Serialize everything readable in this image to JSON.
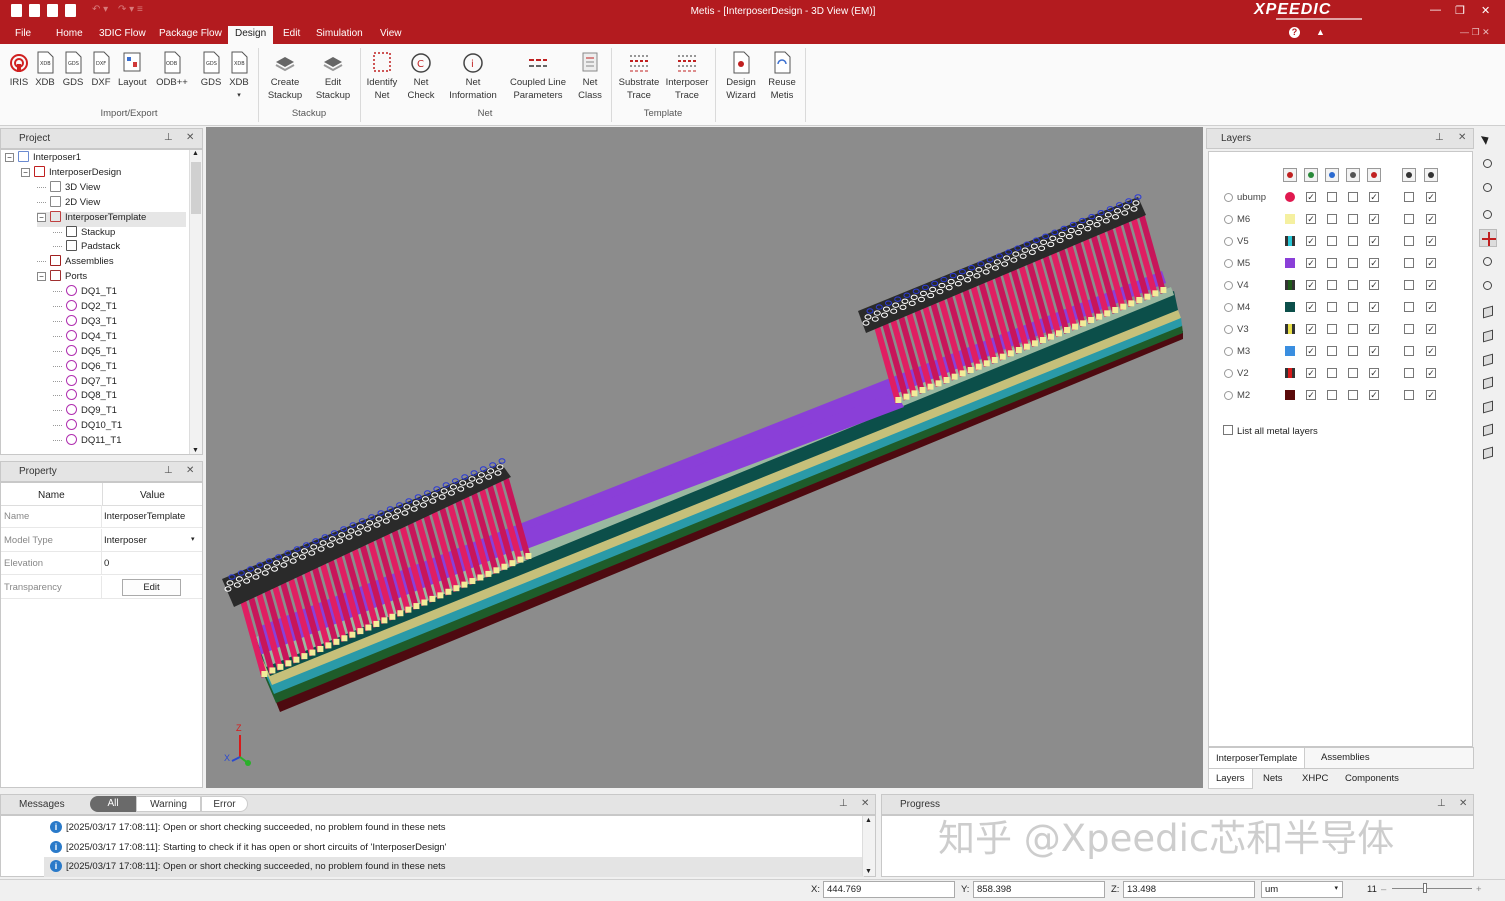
{
  "app": {
    "title": "Metis - [InterposerDesign - 3D View (EM)]",
    "logo": "XPEEDIC"
  },
  "menu": [
    "File",
    "Home",
    "3DIC Flow",
    "Package Flow",
    "Design",
    "Edit",
    "Simulation",
    "View"
  ],
  "ribbon": {
    "import_export": {
      "buttons": [
        "IRIS",
        "XDB",
        "GDS",
        "DXF",
        "Layout",
        "ODB++",
        "GDS",
        "XDB"
      ],
      "label": "Import/Export"
    },
    "stackup": {
      "buttons": [
        [
          "Create",
          "Stackup"
        ],
        [
          "Edit",
          "Stackup"
        ]
      ],
      "label": "Stackup"
    },
    "net": {
      "buttons": [
        [
          "Identify",
          "Net"
        ],
        [
          "Net",
          "Check"
        ],
        [
          "Net",
          "Information"
        ],
        [
          "Coupled Line",
          "Parameters"
        ],
        [
          "Net",
          "Class"
        ]
      ],
      "label": "Net"
    },
    "template": {
      "buttons": [
        [
          "Substrate",
          "Trace"
        ],
        [
          "Interposer",
          "Trace"
        ]
      ],
      "label": "Template"
    },
    "misc": {
      "buttons": [
        [
          "Design",
          "Wizard"
        ],
        [
          "Reuse",
          "Metis"
        ]
      ]
    }
  },
  "project": {
    "title": "Project",
    "tree": [
      {
        "label": "Interposer1",
        "level": 0,
        "icon": "project-icon",
        "exp": "-"
      },
      {
        "label": "InterposerDesign",
        "level": 1,
        "icon": "design-icon",
        "exp": "-"
      },
      {
        "label": "3D View",
        "level": 2,
        "icon": "3d-view-icon"
      },
      {
        "label": "2D View",
        "level": 2,
        "icon": "2d-view-icon"
      },
      {
        "label": "InterposerTemplate",
        "level": 2,
        "icon": "template-icon",
        "exp": "-",
        "selected": true
      },
      {
        "label": "Stackup",
        "level": 3,
        "icon": "stackup-icon"
      },
      {
        "label": "Padstack",
        "level": 3,
        "icon": "padstack-icon"
      },
      {
        "label": "Assemblies",
        "level": 2,
        "icon": "assemblies-icon"
      },
      {
        "label": "Ports",
        "level": 2,
        "icon": "ports-icon",
        "exp": "-"
      },
      {
        "label": "DQ1_T1",
        "level": 3,
        "icon": "port-icon"
      },
      {
        "label": "DQ2_T1",
        "level": 3,
        "icon": "port-icon"
      },
      {
        "label": "DQ3_T1",
        "level": 3,
        "icon": "port-icon"
      },
      {
        "label": "DQ4_T1",
        "level": 3,
        "icon": "port-icon"
      },
      {
        "label": "DQ5_T1",
        "level": 3,
        "icon": "port-icon"
      },
      {
        "label": "DQ6_T1",
        "level": 3,
        "icon": "port-icon"
      },
      {
        "label": "DQ7_T1",
        "level": 3,
        "icon": "port-icon"
      },
      {
        "label": "DQ8_T1",
        "level": 3,
        "icon": "port-icon"
      },
      {
        "label": "DQ9_T1",
        "level": 3,
        "icon": "port-icon"
      },
      {
        "label": "DQ10_T1",
        "level": 3,
        "icon": "port-icon"
      },
      {
        "label": "DQ11_T1",
        "level": 3,
        "icon": "port-icon"
      }
    ]
  },
  "property": {
    "title": "Property",
    "headers": [
      "Name",
      "Value"
    ],
    "rows": [
      {
        "name": "Name",
        "value": "InterposerTemplate"
      },
      {
        "name": "Model Type",
        "value": "Interposer"
      },
      {
        "name": "Elevation",
        "value": "0"
      },
      {
        "name": "Transparency",
        "value": "Edit"
      }
    ]
  },
  "axes": {
    "z": "Z",
    "x": "X",
    "y": "Y"
  },
  "layers": {
    "title": "Layers",
    "rows": [
      {
        "name": "ubump",
        "color": "#e0194f",
        "shape": "circle",
        "c1": true,
        "c2": false,
        "c3": false,
        "c4": true,
        "c5": false,
        "c6": true
      },
      {
        "name": "M6",
        "color": "#f5f0a0",
        "shape": "square",
        "c1": true,
        "c2": false,
        "c3": false,
        "c4": true,
        "c5": false,
        "c6": true
      },
      {
        "name": "V5",
        "color": "#29c8d8",
        "shape": "via",
        "c1": true,
        "c2": false,
        "c3": false,
        "c4": true,
        "c5": false,
        "c6": true
      },
      {
        "name": "M5",
        "color": "#8a3fd8",
        "shape": "square",
        "c1": true,
        "c2": false,
        "c3": false,
        "c4": true,
        "c5": false,
        "c6": true
      },
      {
        "name": "V4",
        "color": "#1f5a1a",
        "shape": "via",
        "c1": true,
        "c2": false,
        "c3": false,
        "c4": true,
        "c5": false,
        "c6": true
      },
      {
        "name": "M4",
        "color": "#0c4f4a",
        "shape": "square",
        "c1": true,
        "c2": false,
        "c3": false,
        "c4": true,
        "c5": false,
        "c6": true
      },
      {
        "name": "V3",
        "color": "#e8e04a",
        "shape": "via",
        "c1": true,
        "c2": false,
        "c3": false,
        "c4": true,
        "c5": false,
        "c6": true
      },
      {
        "name": "M3",
        "color": "#3a8ee0",
        "shape": "square",
        "c1": true,
        "c2": false,
        "c3": false,
        "c4": true,
        "c5": false,
        "c6": true
      },
      {
        "name": "V2",
        "color": "#d81a1a",
        "shape": "via",
        "c1": true,
        "c2": false,
        "c3": false,
        "c4": true,
        "c5": false,
        "c6": true
      },
      {
        "name": "M2",
        "color": "#5a0a0a",
        "shape": "square",
        "c1": true,
        "c2": false,
        "c3": false,
        "c4": true,
        "c5": false,
        "c6": true
      }
    ],
    "list_all": "List all metal layers",
    "bottom_tabs_1": [
      "InterposerTemplate",
      "Assemblies"
    ],
    "bottom_tabs_2": [
      "Layers",
      "Nets",
      "XHPC",
      "Components"
    ]
  },
  "messages": {
    "title": "Messages",
    "filters": [
      "All",
      "Warning",
      "Error"
    ],
    "rows": [
      "[2025/03/17 17:08:11]: Open or short checking succeeded, no problem found in these nets",
      "[2025/03/17 17:08:11]: Starting to check if it has open or short circuits of 'InterposerDesign'",
      "[2025/03/17 17:08:11]: Open or short checking succeeded, no problem found in these nets"
    ]
  },
  "progress": {
    "title": "Progress"
  },
  "watermark": "知乎 @Xpeedic芯和半导体",
  "status": {
    "x_label": "X:",
    "x": "444.769",
    "y_label": "Y:",
    "y": "858.398",
    "z_label": "Z:",
    "z": "13.498",
    "unit": "um",
    "zoom": "11"
  }
}
